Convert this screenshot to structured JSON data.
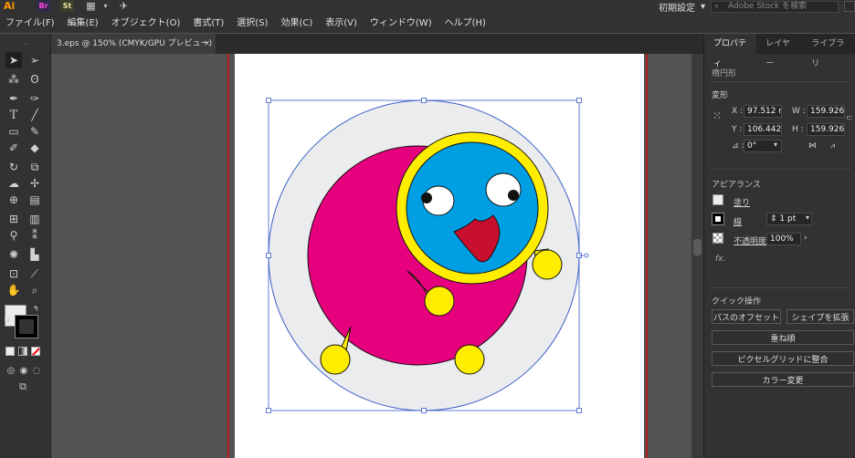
{
  "app": {
    "logo": "Ai",
    "bridges": [
      "Br",
      "St"
    ],
    "workspace": "初期設定",
    "stock_placeholder": "Adobe Stock を検索"
  },
  "menu": [
    "ファイル(F)",
    "編集(E)",
    "オブジェクト(O)",
    "書式(T)",
    "選択(S)",
    "効果(C)",
    "表示(V)",
    "ウィンドウ(W)",
    "ヘルプ(H)"
  ],
  "tab": {
    "title": "3.eps @ 150% (CMYK/GPU プレビュー)",
    "close": "×"
  },
  "panel": {
    "tabs": [
      "プロパティ",
      "レイヤー",
      "ライブラリ"
    ],
    "object_type": "楕円形",
    "transform_title": "変形",
    "x_label": "X :",
    "x": "97.512 r",
    "w_label": "W :",
    "w": "159.926",
    "y_label": "Y :",
    "y": "106.442",
    "h_label": "H :",
    "h": "159.926",
    "angle_label": "⊿ :",
    "angle": "0°",
    "appearance_title": "アピアランス",
    "fill_label": "塗り",
    "stroke_label": "線",
    "stroke_value": "1 pt",
    "opacity_label": "不透明度",
    "opacity": "100%",
    "fx": "fx.",
    "quick_title": "クイック操作",
    "buttons": [
      "パスのオフセット",
      "シェイプを拡張",
      "重ね順",
      "ピクセルグリッドに整合",
      "カラー変更"
    ]
  },
  "colors": {
    "magenta": "#e6007e",
    "cyan": "#009fe3",
    "yellow": "#ffed00",
    "mouth": "#c8102e",
    "ring": "#ebeced"
  }
}
